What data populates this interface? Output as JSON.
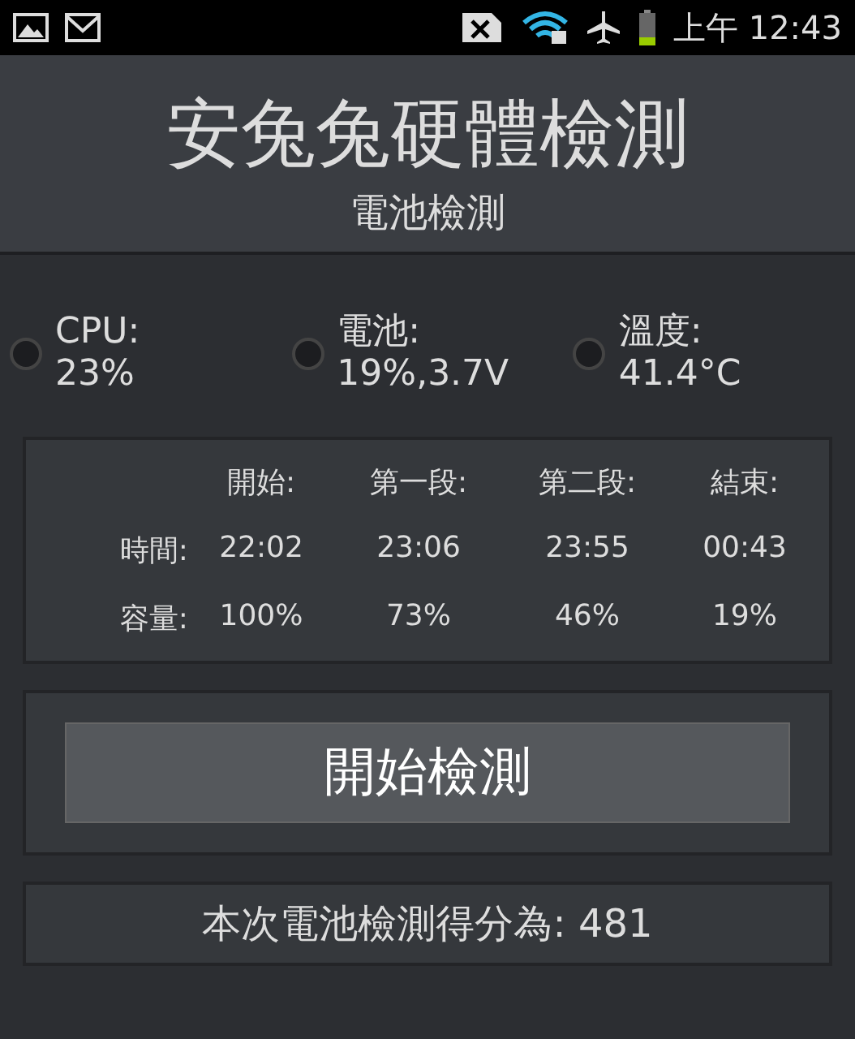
{
  "status_bar": {
    "time": "上午 12:43"
  },
  "header": {
    "title": "安兔兔硬體檢測",
    "subtitle": "電池檢測"
  },
  "stats": [
    {
      "label": "CPU:",
      "value": "23%",
      "on": false
    },
    {
      "label": "電池:",
      "value": "19%,3.7V",
      "on": false
    },
    {
      "label": "溫度:",
      "value": "41.4°C",
      "on": false
    }
  ],
  "table": {
    "columns": [
      "開始:",
      "第一段:",
      "第二段:",
      "結束:"
    ],
    "rows": [
      {
        "label": "時間:",
        "cells": [
          "22:02",
          "23:06",
          "23:55",
          "00:43"
        ]
      },
      {
        "label": "容量:",
        "cells": [
          "100%",
          "73%",
          "46%",
          "19%"
        ]
      }
    ]
  },
  "start_button": {
    "label": "開始檢測"
  },
  "score": {
    "text": "本次電池檢測得分為: 481"
  }
}
